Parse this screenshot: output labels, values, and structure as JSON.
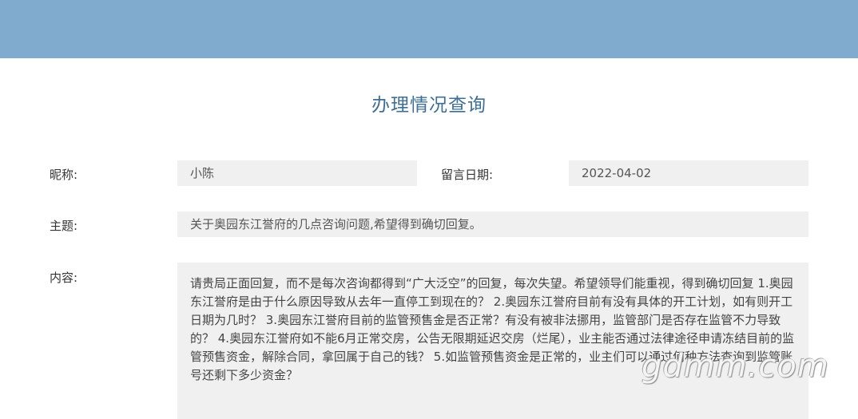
{
  "page": {
    "title": "办理情况查询"
  },
  "form": {
    "nickname_label": "昵称:",
    "nickname_value": "小陈",
    "date_label": "留言日期:",
    "date_value": "2022-04-02",
    "subject_label": "主题:",
    "subject_value": "关于奥园东江誉府的几点咨询问题,希望得到确切回复。",
    "content_label": "内容:",
    "content_value": "请贵局正面回复，而不是每次咨询都得到“广大泛空”的回复，每次失望。希望领导们能重视，得到确切回复 1.奥园东江誉府是由于什么原因导致从去年一直停工到现在的？ 2.奥园东江誉府目前有没有具体的开工计划，如有则开工日期为几时？ 3.奥园东江誉府目前的监管预售金是否正常？有没有被非法挪用，监管部门是否存在监管不力导致的？ 4.奥园东江誉府如不能6月正常交房，公告无限期延迟交房（烂尾），业主能否通过法律途径申请冻结目前的监管预售资金，解除合同，拿回属于自己的钱？ 5.如监管预售资金是正常的，业主们可以通过何种方法查询到监管账号还剩下多少资金？"
  },
  "watermark": {
    "text": "gdmm.com"
  },
  "colors": {
    "banner": "#80abcf",
    "title": "#3f6f95",
    "field_bg": "#f0f0f0"
  }
}
